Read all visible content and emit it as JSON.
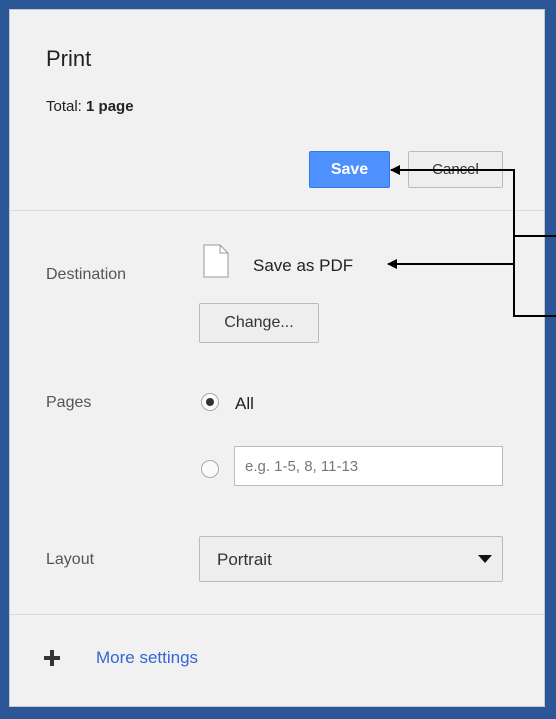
{
  "header": {
    "title": "Print",
    "total_label": "Total:",
    "total_value": "1 page"
  },
  "buttons": {
    "save": "Save",
    "cancel": "Cancel",
    "change": "Change..."
  },
  "destination": {
    "label": "Destination",
    "value": "Save as PDF"
  },
  "pages": {
    "label": "Pages",
    "option_all": "All",
    "custom_placeholder": "e.g. 1-5, 8, 11-13",
    "selected": "All"
  },
  "layout": {
    "label": "Layout",
    "selected": "Portrait"
  },
  "more_settings": {
    "label": "More settings"
  },
  "colors": {
    "accent": "#4d90fe",
    "link": "#3367d6",
    "frame": "#2c5797",
    "panel": "#f1f1f1"
  }
}
